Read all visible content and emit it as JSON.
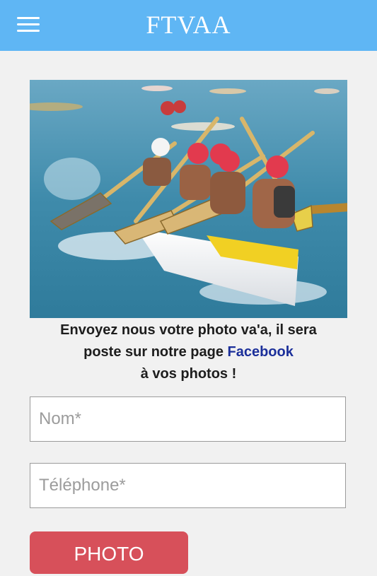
{
  "header": {
    "title": "FTVAA",
    "menu_icon": "hamburger-menu-icon",
    "background": "#5fb6f4"
  },
  "intro": {
    "line1": "Envoyez nous votre photo va'a, il sera",
    "line2_prefix": "poste sur notre page ",
    "facebook_link": "Facebook",
    "line3": "à vos photos !"
  },
  "form": {
    "name_placeholder": "Nom*",
    "phone_placeholder": "Téléphone*",
    "photo_button": "PHOTO"
  },
  "colors": {
    "accent": "#5fb6f4",
    "button": "#d7505a",
    "link": "#1b2f9a"
  }
}
